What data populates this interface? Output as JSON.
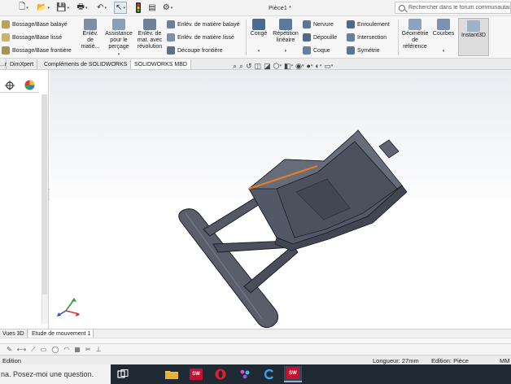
{
  "titlebar": {
    "document_title": "Pièce1 *",
    "search_placeholder": "Rechercher dans le forum communautaire"
  },
  "ribbon": {
    "boss_swept": "Bossage/Base balayé",
    "boss_loft": "Bossage/Base lissé",
    "boss_boundary": "Bossage/Base frontière",
    "hole_wizard_label_1": "Enlév.",
    "hole_wizard_label_2": "de",
    "hole_wizard_label_3": "matiè...",
    "hole_assist_1": "Assistance",
    "hole_assist_2": "pour le",
    "hole_assist_3": "perçage",
    "revolved_cut_1": "Enlév. de",
    "revolved_cut_2": "mat. avec",
    "revolved_cut_3": "révolution",
    "swept_cut": "Enlév. de matière balayé",
    "lofted_cut": "Enlév. de matière lissé",
    "boundary_cut": "Découpe frontière",
    "fillet": "Congé",
    "pattern_1": "Répétition",
    "pattern_2": "linéaire",
    "rib": "Nervure",
    "draft": "Dépouille",
    "shell": "Coque",
    "wrap": "Enroulement",
    "intersect": "Intersection",
    "mirror": "Symétrie",
    "ref_geom_1": "Géométrie",
    "ref_geom_2": "de",
    "ref_geom_3": "référence",
    "curves": "Courbes",
    "instant3d": "Instant3D"
  },
  "command_tabs": [
    "...r",
    "DimXpert",
    "Compléments de SOLIDWORKS",
    "SOLIDWORKS MBD"
  ],
  "model_tabs": [
    "Vues 3D",
    "Etude de mouvement 1"
  ],
  "status": {
    "mode": "Edition",
    "length": "Longueur: 27mm",
    "edit_context": "Edition: Pièce",
    "units": "MM"
  },
  "taskbar": {
    "cortana_text": "na. Posez-moi une question.",
    "sw_badge": "SW"
  },
  "colors": {
    "part_body": "#535866",
    "selected_edge": "#e67e22",
    "viewport_top": "#eaecf1",
    "taskbar": "#1f2a35"
  }
}
